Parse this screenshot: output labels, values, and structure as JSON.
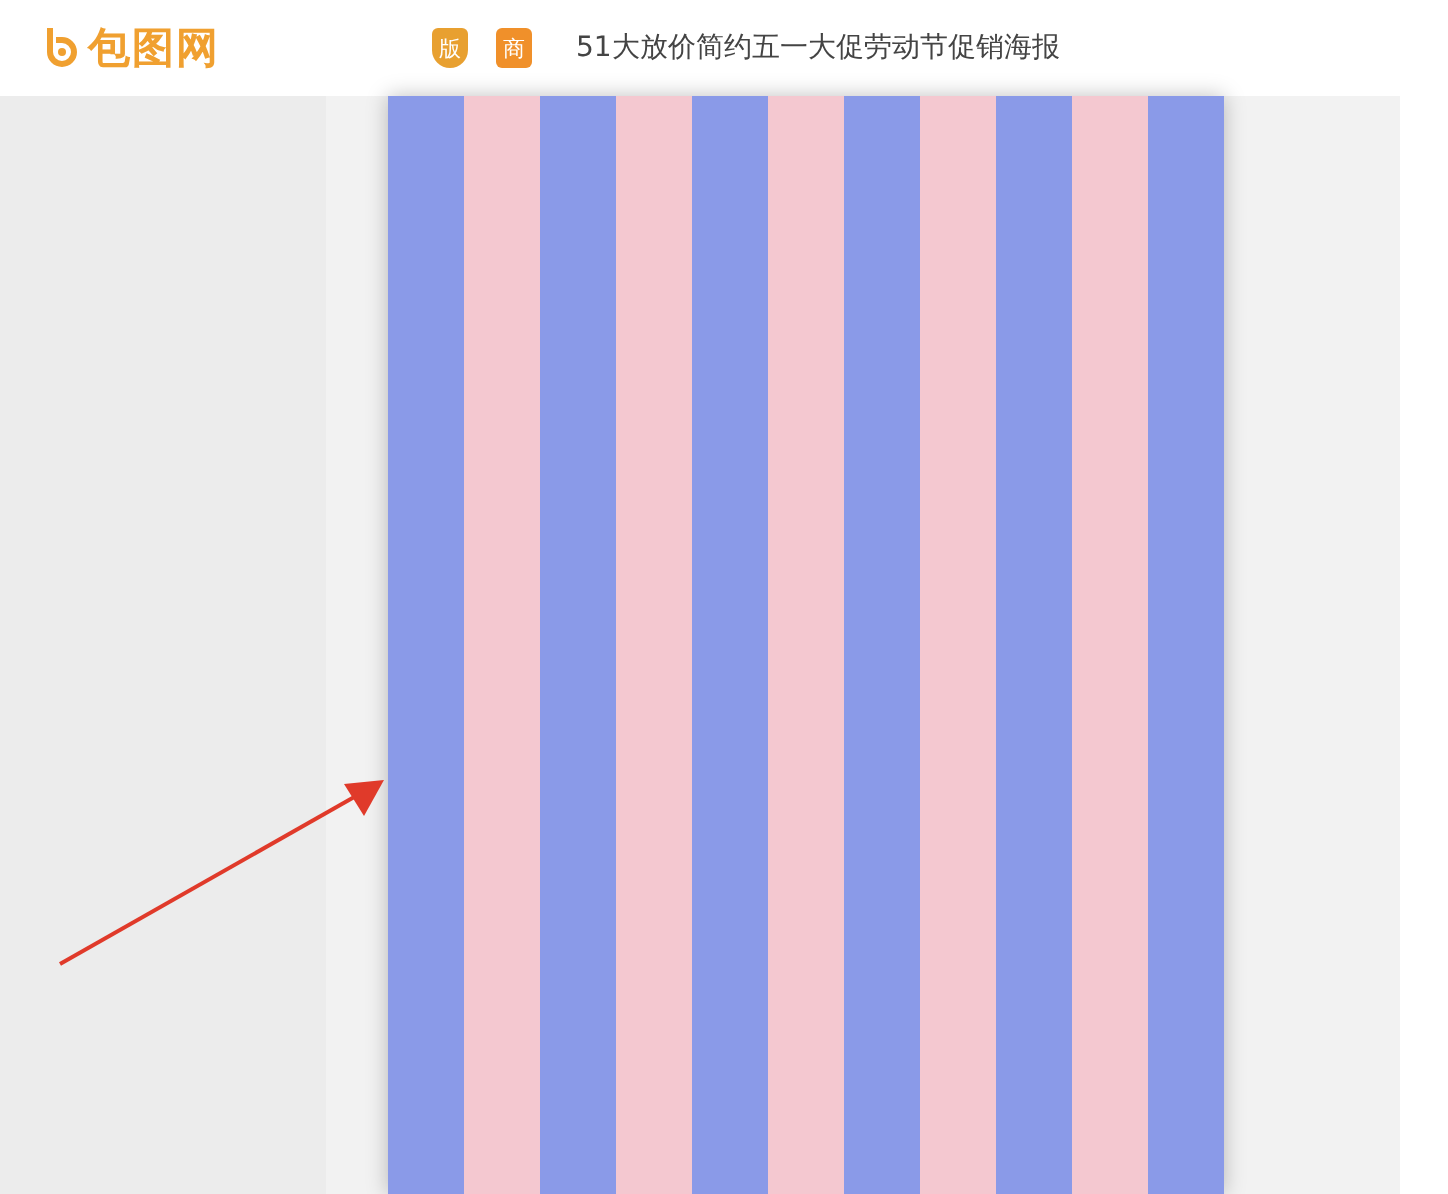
{
  "header": {
    "logo": "包图网",
    "badges": [
      {
        "label": "版",
        "kind": "shield"
      },
      {
        "label": "商",
        "kind": "square"
      }
    ],
    "title": "51大放价简约五一大促劳动节促销海报"
  }
}
